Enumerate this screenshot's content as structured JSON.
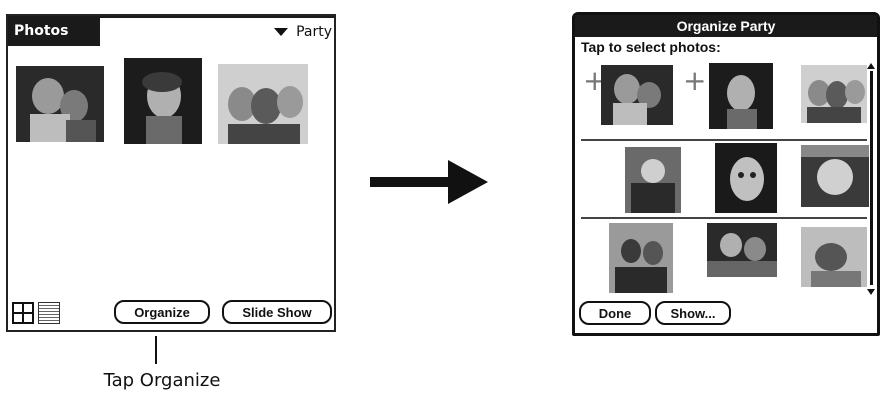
{
  "left_screen": {
    "app_title": "Photos",
    "album_name": "Party",
    "buttons": {
      "organize": "Organize",
      "slide_show": "Slide Show"
    }
  },
  "callout": "Tap Organize",
  "right_screen": {
    "title": "Organize Party",
    "prompt": "Tap to select photos:",
    "plus": "+",
    "buttons": {
      "done": "Done",
      "show": "Show..."
    }
  },
  "colors": {
    "ink": "#111111",
    "titlebar": "#1a1a1a",
    "background": "#ffffff"
  },
  "icons": {
    "thumbnail_view": "grid-view-icon",
    "list_view": "list-view-icon",
    "arrow": "right-arrow-icon",
    "album_dropdown": "triangle-down-icon"
  }
}
